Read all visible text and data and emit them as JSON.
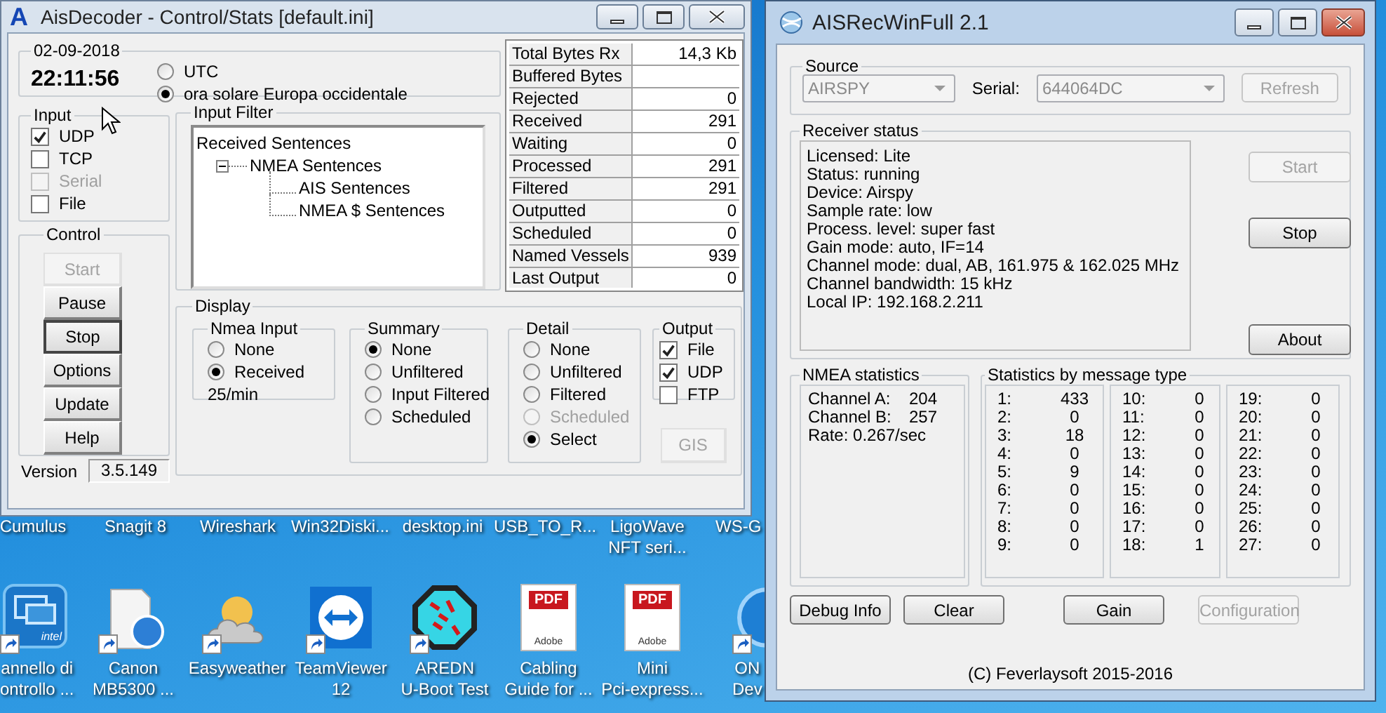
{
  "desktop": {
    "top_labels": [
      "Cumulus",
      "Snagit 8",
      "Wireshark",
      "Win32Diski...",
      "desktop.ini",
      "USB_TO_R...",
      "LigoWave\nNFT seri...",
      "WS-G"
    ],
    "icons": [
      {
        "kind": "panel",
        "label": "annello di\nontrollo ...",
        "shortcut": true,
        "caption": "intel"
      },
      {
        "kind": "document",
        "label": "Canon\nMB5300 ...",
        "shortcut": true
      },
      {
        "kind": "weather",
        "label": "Easyweather",
        "shortcut": true
      },
      {
        "kind": "remote",
        "label": "TeamViewer\n12",
        "shortcut": true
      },
      {
        "kind": "octagon",
        "label": "AREDN\nU-Boot Test",
        "shortcut": true
      },
      {
        "kind": "pdf",
        "label": "Cabling\nGuide for ...",
        "shortcut": false,
        "badge": "PDF",
        "caption": "Adobe"
      },
      {
        "kind": "pdf",
        "label": "Mini\nPci-express...",
        "shortcut": false,
        "badge": "PDF",
        "caption": "Adobe"
      },
      {
        "kind": "disc",
        "label": "ON\nDev",
        "shortcut": true
      }
    ]
  },
  "aisdecoder": {
    "logo": "A",
    "title": "AisDecoder - Control/Stats [default.ini]",
    "clock": {
      "date": "02-09-2018",
      "time": "22:11:56"
    },
    "timezone": [
      {
        "label": "UTC",
        "selected": false
      },
      {
        "label": "ora solare Europa occidentale",
        "selected": true
      }
    ],
    "input": {
      "label": "Input",
      "items": [
        {
          "label": "UDP",
          "checked": true,
          "disabled": false
        },
        {
          "label": "TCP",
          "checked": false,
          "disabled": false
        },
        {
          "label": "Serial",
          "checked": false,
          "disabled": true
        },
        {
          "label": "File",
          "checked": false,
          "disabled": false
        }
      ]
    },
    "control": {
      "label": "Control",
      "buttons": [
        {
          "label": "Start",
          "disabled": true,
          "focused": false
        },
        {
          "label": "Pause",
          "disabled": false,
          "focused": false
        },
        {
          "label": "Stop",
          "disabled": false,
          "focused": true
        },
        {
          "label": "Options",
          "disabled": false,
          "focused": false
        },
        {
          "label": "Update",
          "disabled": false,
          "focused": false
        },
        {
          "label": "Help",
          "disabled": false,
          "focused": false
        }
      ]
    },
    "version": {
      "label": "Version",
      "value": "3.5.149"
    },
    "input_filter": {
      "label": "Input Filter",
      "tree": [
        {
          "label": "Received Sentences",
          "children": [
            {
              "label": "NMEA Sentences",
              "expanded": true,
              "children": [
                {
                  "label": "AIS Sentences"
                },
                {
                  "label": "NMEA $ Sentences"
                }
              ]
            }
          ]
        }
      ]
    },
    "stats": [
      {
        "label": "Total Bytes Rx",
        "value": "14,3 Kb"
      },
      {
        "label": "Buffered Bytes"
      },
      {
        "label": "Rejected",
        "value": "0"
      },
      {
        "label": "Received",
        "value": "291"
      },
      {
        "label": "Waiting",
        "value": "0"
      },
      {
        "label": "Processed",
        "value": "291"
      },
      {
        "label": "Filtered",
        "value": "291"
      },
      {
        "label": "Outputted",
        "value": "0"
      },
      {
        "label": "Scheduled",
        "value": "0"
      },
      {
        "label": "Named Vessels",
        "value": "939"
      },
      {
        "label": "Last Output",
        "value": "0"
      }
    ],
    "display": {
      "label": "Display",
      "nmea_input": {
        "label": "Nmea Input",
        "options": [
          {
            "label": "None",
            "selected": false,
            "disabled": false
          },
          {
            "label": "Received",
            "selected": true,
            "disabled": false
          }
        ],
        "rate": "25/min"
      },
      "summary": {
        "label": "Summary",
        "options": [
          {
            "label": "None",
            "selected": true,
            "disabled": false
          },
          {
            "label": "Unfiltered",
            "selected": false,
            "disabled": false
          },
          {
            "label": "Input Filtered",
            "selected": false,
            "disabled": false
          },
          {
            "label": "Scheduled",
            "selected": false,
            "disabled": false
          }
        ]
      },
      "detail": {
        "label": "Detail",
        "options": [
          {
            "label": "None",
            "selected": false,
            "disabled": false
          },
          {
            "label": "Unfiltered",
            "selected": false,
            "disabled": false
          },
          {
            "label": "Filtered",
            "selected": false,
            "disabled": false
          },
          {
            "label": "Scheduled",
            "selected": false,
            "disabled": true
          },
          {
            "label": "Select",
            "selected": true,
            "disabled": false
          }
        ]
      },
      "output": {
        "label": "Output",
        "items": [
          {
            "label": "File",
            "checked": true,
            "disabled": false
          },
          {
            "label": "UDP",
            "checked": true,
            "disabled": false
          },
          {
            "label": "FTP",
            "checked": false,
            "disabled": false
          }
        ]
      },
      "gis_button": {
        "label": "GIS",
        "disabled": true
      }
    }
  },
  "aisrec": {
    "title": "AISRecWinFull 2.1",
    "source": {
      "label": "Source",
      "device": "AIRSPY",
      "serial_label": "Serial:",
      "serial": "644064DC",
      "refresh": {
        "label": "Refresh",
        "disabled": true
      }
    },
    "receiver_status": {
      "label": "Receiver status",
      "lines": [
        "Licensed: Lite",
        "Status: running",
        "Device: Airspy",
        "Sample rate: low",
        "Process. level: super fast",
        "Gain mode: auto, IF=14",
        "Channel mode: dual, AB, 161.975 & 162.025 MHz",
        "Channel bandwidth: 15 kHz",
        "Local IP: 192.168.2.211"
      ],
      "buttons": [
        {
          "label": "Start",
          "disabled": true
        },
        {
          "label": "Stop",
          "disabled": false
        },
        {
          "label": "About",
          "disabled": false
        }
      ]
    },
    "nmea_statistics": {
      "label": "NMEA statistics",
      "channels": [
        {
          "label": "Channel A:",
          "value": "204"
        },
        {
          "label": "Channel B:",
          "value": "257"
        }
      ],
      "rate": "Rate:  0.267/sec"
    },
    "message_stats": {
      "label": "Statistics by message type",
      "rows": [
        {
          "type": "1:",
          "count": "433"
        },
        {
          "type": "2:",
          "count": "0"
        },
        {
          "type": "3:",
          "count": "18"
        },
        {
          "type": "4:",
          "count": "0"
        },
        {
          "type": "5:",
          "count": "9"
        },
        {
          "type": "6:",
          "count": "0"
        },
        {
          "type": "7:",
          "count": "0"
        },
        {
          "type": "8:",
          "count": "0"
        },
        {
          "type": "9:",
          "count": "0"
        },
        {
          "type": "10:",
          "count": "0"
        },
        {
          "type": "11:",
          "count": "0"
        },
        {
          "type": "12:",
          "count": "0"
        },
        {
          "type": "13:",
          "count": "0"
        },
        {
          "type": "14:",
          "count": "0"
        },
        {
          "type": "15:",
          "count": "0"
        },
        {
          "type": "16:",
          "count": "0"
        },
        {
          "type": "17:",
          "count": "0"
        },
        {
          "type": "18:",
          "count": "1"
        },
        {
          "type": "19:",
          "count": "0"
        },
        {
          "type": "20:",
          "count": "0"
        },
        {
          "type": "21:",
          "count": "0"
        },
        {
          "type": "22:",
          "count": "0"
        },
        {
          "type": "23:",
          "count": "0"
        },
        {
          "type": "24:",
          "count": "0"
        },
        {
          "type": "25:",
          "count": "0"
        },
        {
          "type": "26:",
          "count": "0"
        },
        {
          "type": "27:",
          "count": "0"
        }
      ]
    },
    "buttons": [
      {
        "label": "Debug Info",
        "disabled": false
      },
      {
        "label": "Clear",
        "disabled": false
      },
      {
        "label": "Gain",
        "disabled": false
      },
      {
        "label": "Configuration",
        "disabled": true
      }
    ],
    "copyright": "(C) Feverlaysoft 2015-2016"
  }
}
